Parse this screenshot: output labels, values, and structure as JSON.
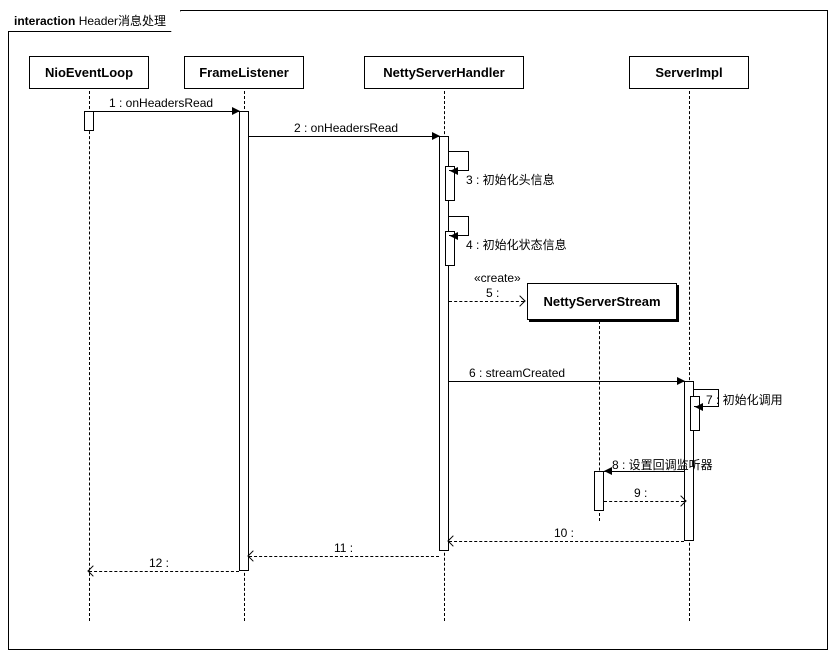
{
  "frame": {
    "keyword": "interaction",
    "title": "Header消息处理"
  },
  "lifelines": {
    "l1": "NioEventLoop",
    "l2": "FrameListener",
    "l3": "NettyServerHandler",
    "l4": "ServerImpl"
  },
  "created_object": {
    "name": "NettyServerStream"
  },
  "messages": {
    "m1": "1 : onHeadersRead",
    "m2": "2 : onHeadersRead",
    "m3": "3 : 初始化头信息",
    "m4": "4 : 初始化状态信息",
    "m5_stereo": "«create»",
    "m5": "5 :",
    "m6": "6 : streamCreated",
    "m7": "7 : 初始化调用",
    "m8": "8 : 设置回调监听器",
    "m9": "9 :",
    "m10": "10 :",
    "m11": "11 :",
    "m12": "12 :"
  },
  "chart_data": {
    "type": "sequence_diagram",
    "title": "interaction Header消息处理",
    "lifelines": [
      {
        "id": "NioEventLoop"
      },
      {
        "id": "FrameListener"
      },
      {
        "id": "NettyServerHandler"
      },
      {
        "id": "ServerImpl"
      },
      {
        "id": "NettyServerStream",
        "created_by_msg": 5
      }
    ],
    "messages": [
      {
        "seq": 1,
        "from": "NioEventLoop",
        "to": "FrameListener",
        "label": "onHeadersRead",
        "type": "sync"
      },
      {
        "seq": 2,
        "from": "FrameListener",
        "to": "NettyServerHandler",
        "label": "onHeadersRead",
        "type": "sync"
      },
      {
        "seq": 3,
        "from": "NettyServerHandler",
        "to": "NettyServerHandler",
        "label": "初始化头信息",
        "type": "self"
      },
      {
        "seq": 4,
        "from": "NettyServerHandler",
        "to": "NettyServerHandler",
        "label": "初始化状态信息",
        "type": "self"
      },
      {
        "seq": 5,
        "from": "NettyServerHandler",
        "to": "NettyServerStream",
        "label": "",
        "type": "create",
        "stereotype": "«create»"
      },
      {
        "seq": 6,
        "from": "NettyServerHandler",
        "to": "ServerImpl",
        "label": "streamCreated",
        "type": "sync"
      },
      {
        "seq": 7,
        "from": "ServerImpl",
        "to": "ServerImpl",
        "label": "初始化调用",
        "type": "self"
      },
      {
        "seq": 8,
        "from": "ServerImpl",
        "to": "NettyServerStream",
        "label": "设置回调监听器",
        "type": "sync"
      },
      {
        "seq": 9,
        "from": "NettyServerStream",
        "to": "ServerImpl",
        "label": "",
        "type": "return"
      },
      {
        "seq": 10,
        "from": "ServerImpl",
        "to": "NettyServerHandler",
        "label": "",
        "type": "return"
      },
      {
        "seq": 11,
        "from": "NettyServerHandler",
        "to": "FrameListener",
        "label": "",
        "type": "return"
      },
      {
        "seq": 12,
        "from": "FrameListener",
        "to": "NioEventLoop",
        "label": "",
        "type": "return"
      }
    ]
  }
}
